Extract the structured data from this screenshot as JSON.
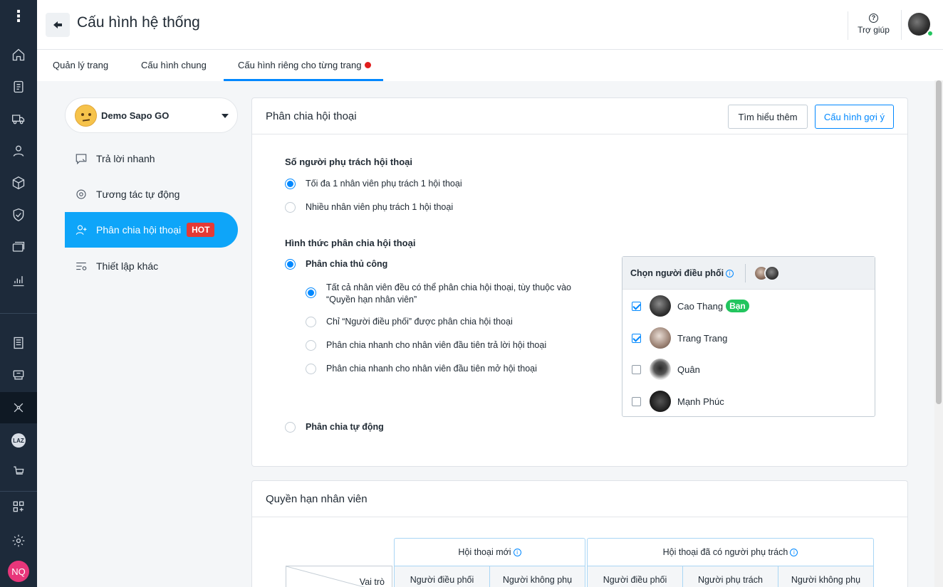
{
  "header": {
    "title": "Cấu hình hệ thống",
    "help_label": "Trợ giúp"
  },
  "tabs": [
    {
      "label": "Quản lý trang"
    },
    {
      "label": "Cấu hình chung"
    },
    {
      "label": "Cấu hình riêng cho từng trang"
    }
  ],
  "sidebar": {
    "page_name": "Demo Sapo GO",
    "items": [
      {
        "label": "Trả lời nhanh"
      },
      {
        "label": "Tương tác tự động"
      },
      {
        "label": "Phân chia hội thoại",
        "badge": "HOT"
      },
      {
        "label": "Thiết lập khác"
      }
    ]
  },
  "rail": {
    "items": [
      "home-icon",
      "document-icon",
      "truck-icon",
      "user-icon",
      "box-icon",
      "shield-icon",
      "card-icon",
      "chart-icon",
      "store-icon",
      "pos-icon",
      "social-icon",
      "lazada-icon",
      "shopee-icon",
      "apps-icon",
      "settings-icon"
    ],
    "laz_text": "LAZ",
    "user_initials": "NQ"
  },
  "assign_card": {
    "title": "Phân chia hội thoại",
    "learn_more": "Tìm hiểu thêm",
    "suggested_config": "Cấu hình gợi ý",
    "section1_label": "Số người phụ trách hội thoại",
    "section1_options": [
      "Tối đa 1 nhân viên phụ trách 1 hội thoại",
      "Nhiều nhân viên phụ trách 1 hội thoại"
    ],
    "section2_label": "Hình thức phân chia hội thoại",
    "manual_label": "Phân chia thủ công",
    "manual_options": [
      "Tất cả nhân viên đều có thể phân chia hội thoại, tùy thuộc vào",
      "“Quyền hạn nhân viên”",
      "Chỉ “Người điều phối” được phân chia hội thoại",
      "Phân chia nhanh cho nhân viên đầu tiên trả lời hội thoại",
      "Phân chia nhanh cho nhân viên đầu tiên mở hội thoại"
    ],
    "auto_label": "Phân chia tự động"
  },
  "coordinator": {
    "title": "Chọn người điều phối",
    "members": [
      {
        "name": "Cao Thang",
        "checked": true,
        "badge": "Bạn"
      },
      {
        "name": "Trang Trang",
        "checked": true
      },
      {
        "name": "Quân",
        "checked": false
      },
      {
        "name": "Mạnh Phúc",
        "checked": false
      }
    ]
  },
  "permissions_card": {
    "title": "Quyền hạn nhân viên",
    "group_new": "Hội thoại mới",
    "group_assigned": "Hội thoại đã có người phụ trách",
    "role_label": "Vai trò",
    "columns": [
      "Người điều phối",
      "Người không phụ",
      "Người điều phối",
      "Người phụ trách",
      "Người không phụ"
    ]
  }
}
